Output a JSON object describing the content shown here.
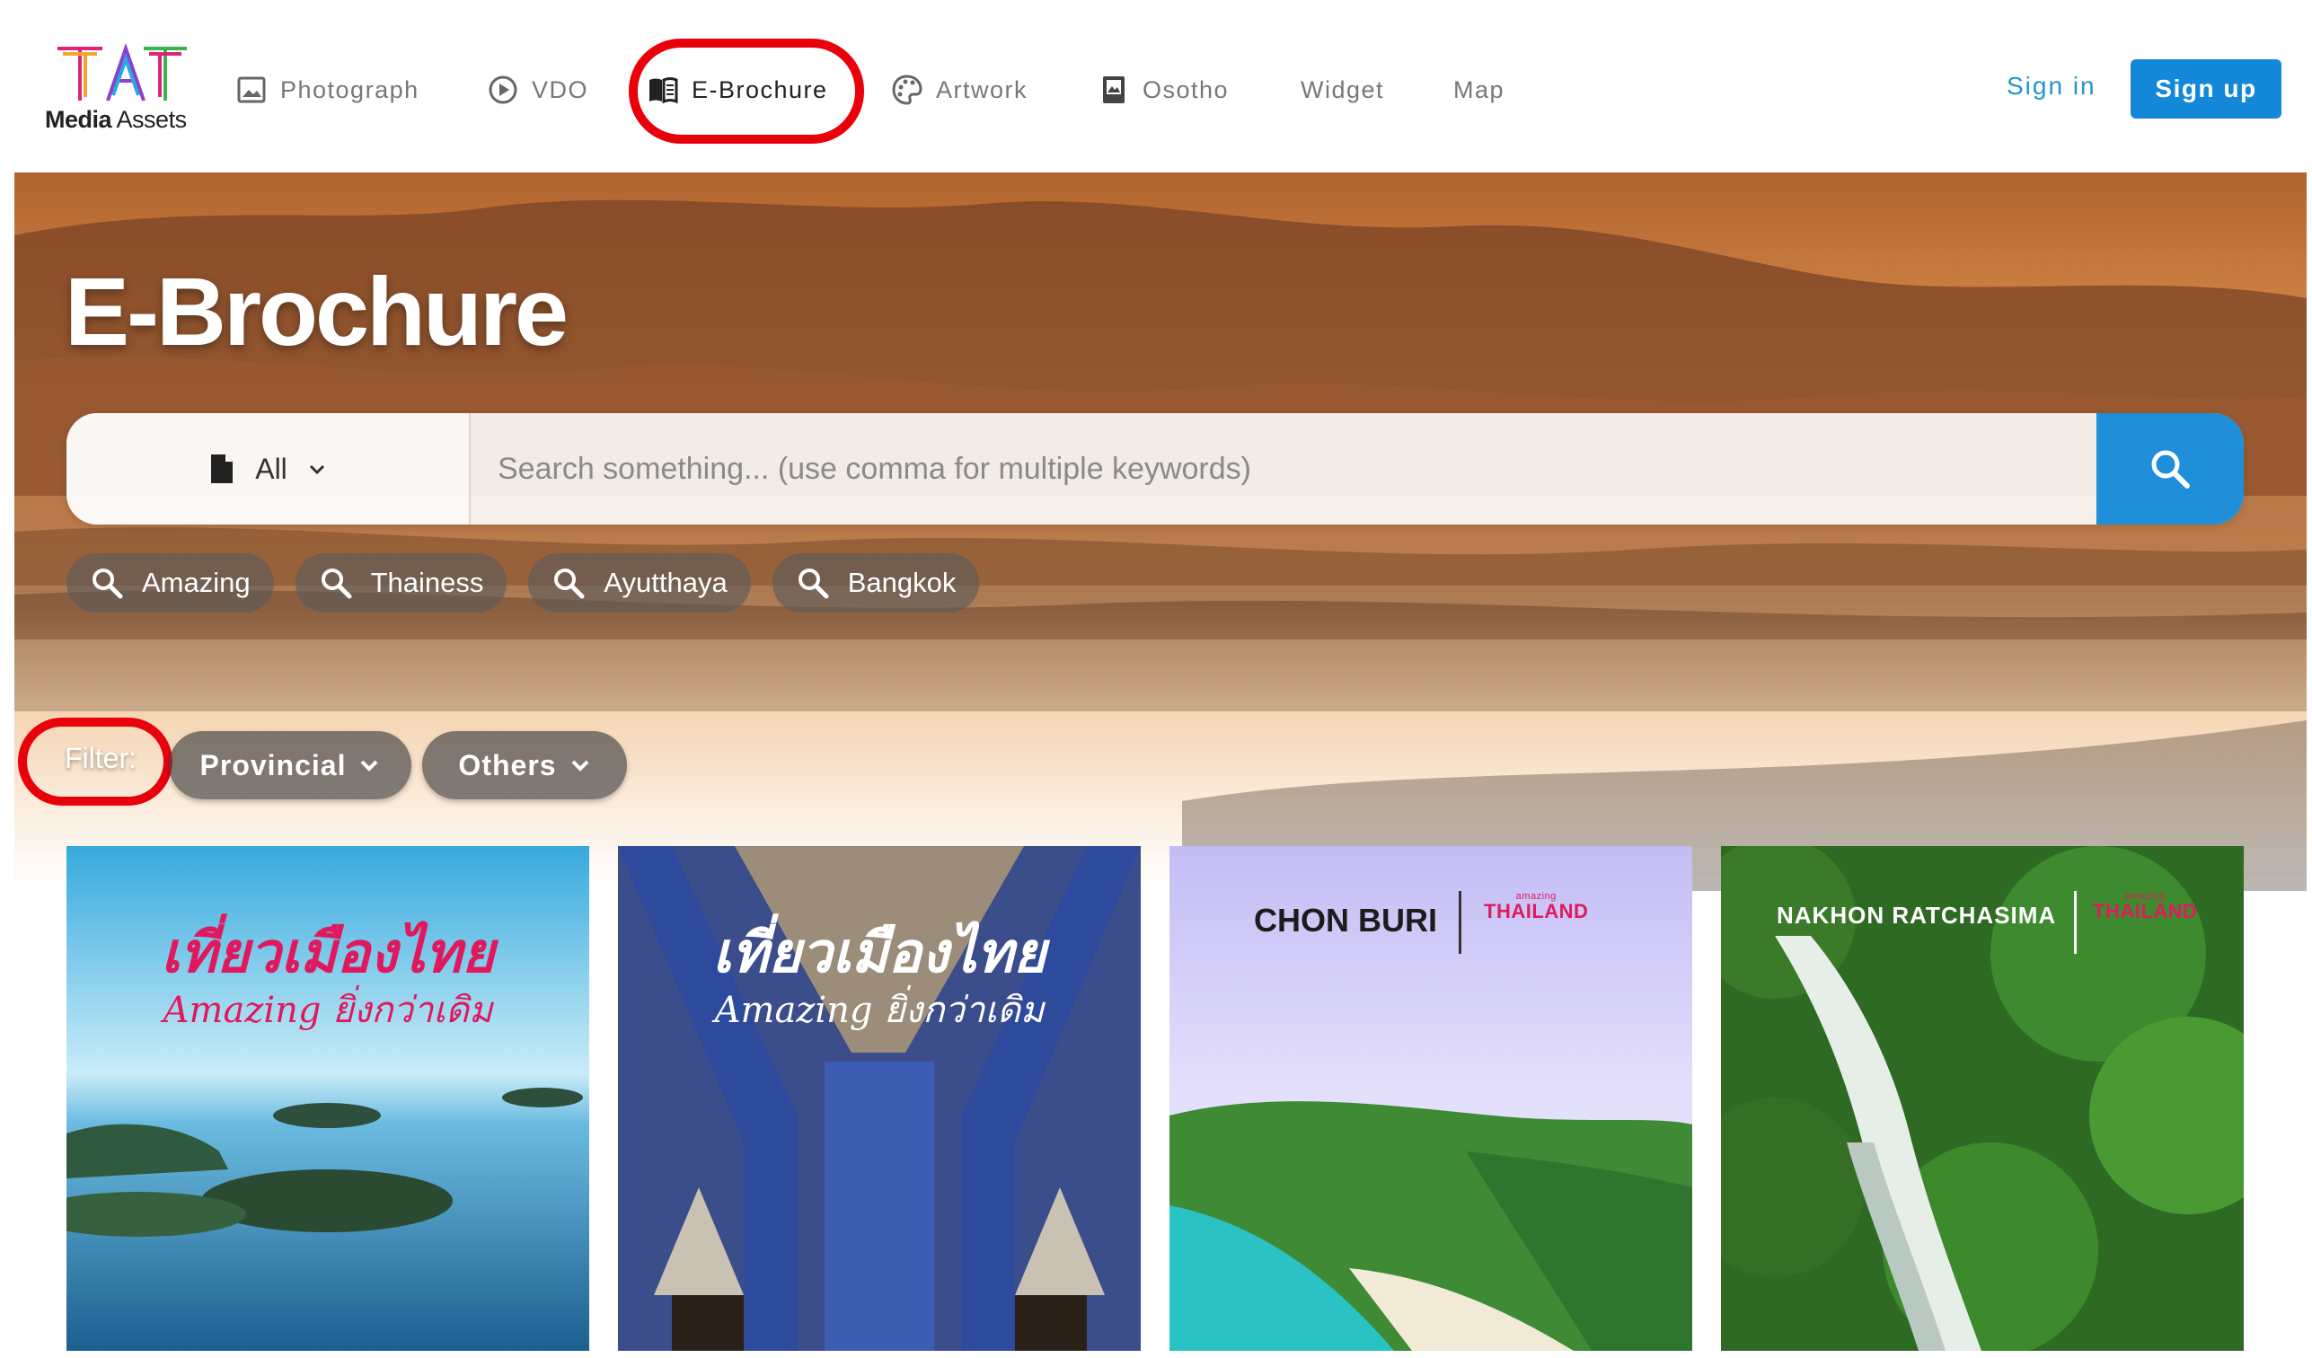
{
  "header": {
    "logo": {
      "mark": "TAT",
      "text_bold": "Media",
      "text_rest": " Assets"
    },
    "nav": [
      {
        "label": "Photograph",
        "icon": "image-icon"
      },
      {
        "label": "VDO",
        "icon": "play-circle-icon"
      },
      {
        "label": "E-Brochure",
        "icon": "book-open-icon",
        "active": true
      },
      {
        "label": "Artwork",
        "icon": "palette-icon"
      },
      {
        "label": "Osotho",
        "icon": "bookmark-photo-icon"
      },
      {
        "label": "Widget"
      },
      {
        "label": "Map"
      }
    ],
    "sign_in": "Sign in",
    "sign_up": "Sign up"
  },
  "hero": {
    "title": "E-Brochure",
    "search": {
      "type_selected": "All",
      "type_icon": "file-icon",
      "placeholder": "Search something... (use comma for multiple keywords)",
      "button_icon": "search-icon"
    },
    "chips": [
      "Amazing",
      "Thainess",
      "Ayutthaya",
      "Bangkok"
    ],
    "filter": {
      "label": "Filter:",
      "options": [
        "Provincial",
        "Others"
      ]
    }
  },
  "cards": [
    {
      "line1": "เที่ยวเมืองไทย",
      "line2": "Amazing ยิ่งกว่าเดิม"
    },
    {
      "line1": "เที่ยวเมืองไทย",
      "line2": "Amazing ยิ่งกว่าเดิม"
    },
    {
      "city": "CHON BURI",
      "brand_small": "amazing",
      "brand": "THAILAND"
    },
    {
      "city": "NAKHON RATCHASIMA",
      "brand_small": "amazing",
      "brand": "THAILAND"
    }
  ],
  "colors": {
    "accent": "#1488d8",
    "highlight_ring": "#e8000b",
    "card_text_pink": "#e0195e"
  }
}
